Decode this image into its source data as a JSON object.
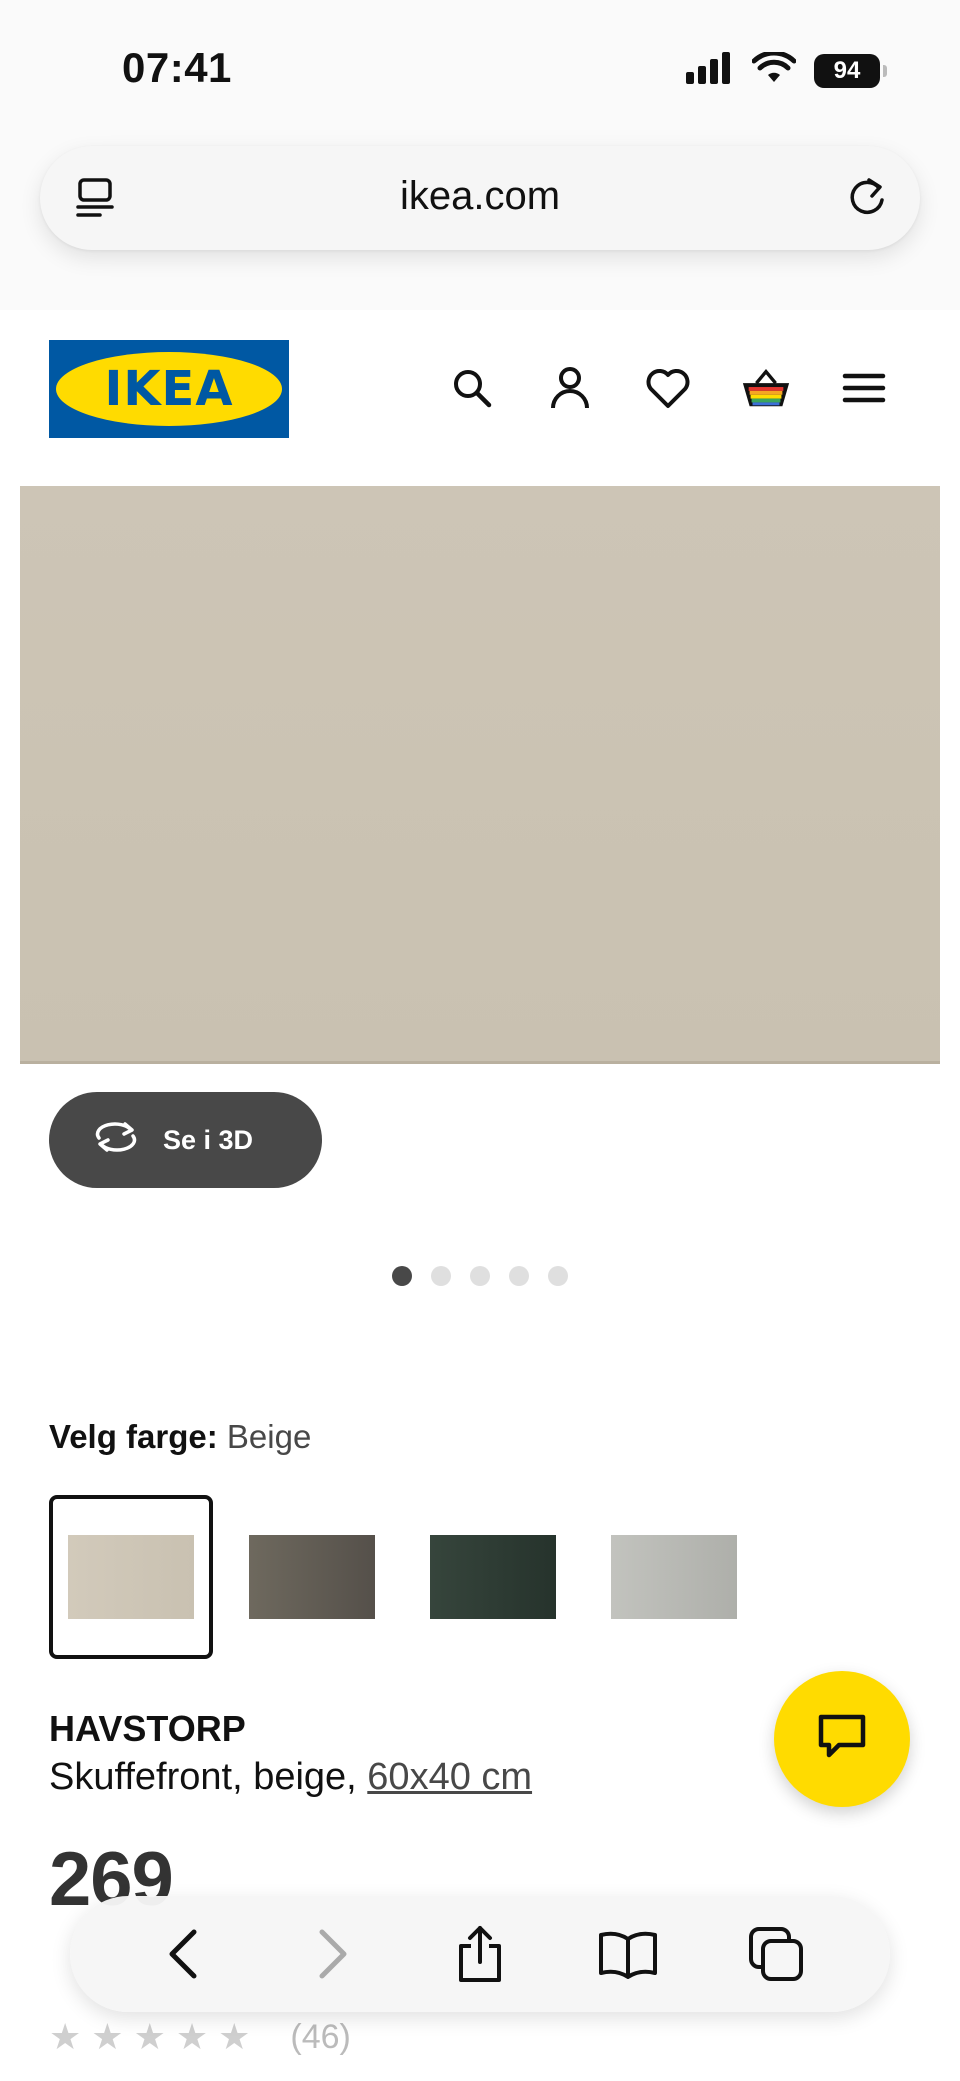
{
  "status_bar": {
    "time": "07:41",
    "battery": "94"
  },
  "browser": {
    "url": "ikea.com"
  },
  "site": {
    "logo_text": "IKEA",
    "header_icons": [
      "search-icon",
      "account-icon",
      "heart-icon",
      "basket-icon",
      "menu-icon"
    ]
  },
  "gallery": {
    "see_3d_label": "Se i 3D",
    "dots_total": 5,
    "dots_active_index": 0
  },
  "color": {
    "label": "Velg farge:",
    "value": "Beige",
    "swatches": [
      {
        "name": "beige",
        "color": "#cdc5b6",
        "selected": true
      },
      {
        "name": "dark-grey-brown",
        "color": "#5f5a50",
        "selected": false
      },
      {
        "name": "dark-green",
        "color": "#2c3a32",
        "selected": false
      },
      {
        "name": "light-grey",
        "color": "#b6b7b2",
        "selected": false
      }
    ]
  },
  "product": {
    "name": "HAVSTORP",
    "desc_prefix": "Skuffefront, beige, ",
    "size": "60x40 cm",
    "price": "269",
    "rating_count": "(46)"
  },
  "colors": {
    "ikea_blue": "#0058a3",
    "ikea_yellow": "#ffdb00"
  }
}
